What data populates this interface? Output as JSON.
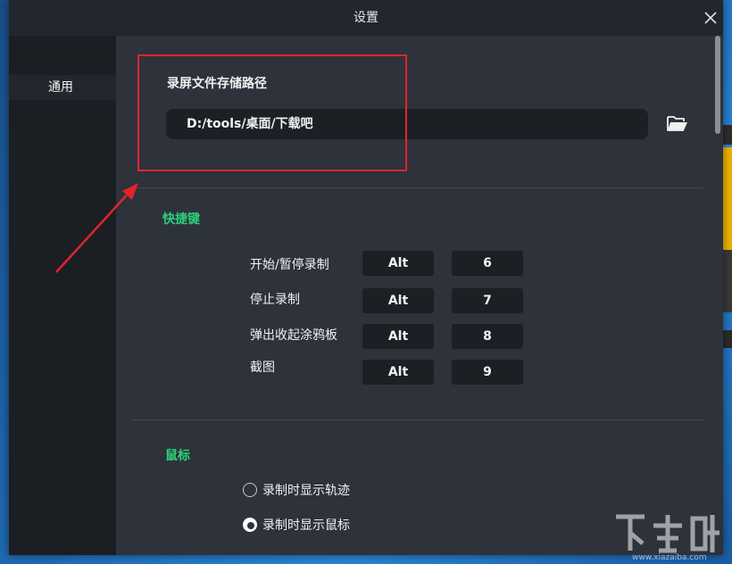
{
  "window": {
    "title": "设置"
  },
  "sidebar": {
    "items": [
      {
        "label": "通用"
      }
    ]
  },
  "recording": {
    "path_label": "录屏文件存储路径",
    "path_value": "D:/tools/桌面/下载吧"
  },
  "hotkeys": {
    "title": "快捷键",
    "rows": [
      {
        "label": "开始/暂停录制",
        "modifier": "Alt",
        "key": "6"
      },
      {
        "label": "停止录制",
        "modifier": "Alt",
        "key": "7"
      },
      {
        "label": "弹出收起涂鸦板",
        "modifier": "Alt",
        "key": "8"
      },
      {
        "label": "截图",
        "modifier": "Alt",
        "key": "9"
      }
    ]
  },
  "mouse": {
    "title": "鼠标",
    "options": [
      {
        "label": "录制时显示轨迹",
        "selected": false
      },
      {
        "label": "录制时显示鼠标",
        "selected": true
      }
    ]
  },
  "watermark": {
    "url": "www.xiazaiba.com"
  },
  "colors": {
    "accent_green": "#2ed07a",
    "annotation_red": "#e0252b",
    "background": "#2d323b"
  }
}
